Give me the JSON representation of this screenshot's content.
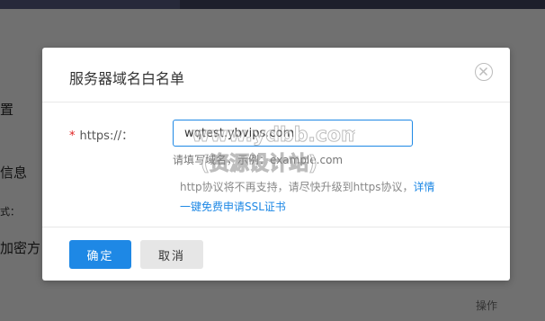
{
  "background": {
    "left_text_1": "置",
    "left_text_2": "信息",
    "left_text_3": "式：",
    "left_text_4": "加密方",
    "right_text_operation": "操作"
  },
  "modal": {
    "title": "服务器域名白名单",
    "field": {
      "required_mark": "*",
      "label": "https://：",
      "value": "wqtest.ybvips.com",
      "hint": "请填写域名，示例：example.com"
    },
    "notice": {
      "text": "http协议将不再支持，请尽快升级到https协议，",
      "details_link": "详情"
    },
    "ssl_link": "一键免费申请SSL证书",
    "footer": {
      "confirm_label": "确定",
      "cancel_label": "取消"
    }
  },
  "watermark": {
    "line1": "www.ydbb.com",
    "line2": "(资源设计站)"
  },
  "colors": {
    "primary": "#1e88e5",
    "overlay": "#707070",
    "required": "#e02020"
  },
  "icons": {
    "close": "close-circle-icon"
  }
}
